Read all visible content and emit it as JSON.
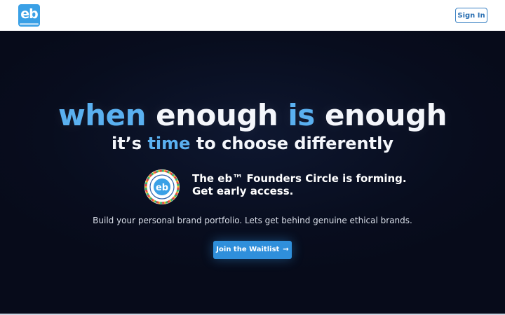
{
  "header": {
    "logo_text": "eb",
    "signin_label": "Sign In"
  },
  "hero": {
    "line1": {
      "w1": "when",
      "w2": "enough",
      "w3": "is",
      "w4": "enough"
    },
    "line2": {
      "w1": "it’s",
      "w2": "time",
      "w3": "to choose differently"
    },
    "founders_line1": "The eb™ Founders Circle is forming.",
    "founders_line2": "Get early access.",
    "seal_text": "eb",
    "tagline": "Build your personal brand portfolio. Lets get behind genuine ethical brands.",
    "cta_label": "Join the Waitlist",
    "cta_icon": "arrow-right-icon"
  },
  "colors": {
    "accent": "#5ab0f0",
    "cta": "#2f8fdb",
    "background": "#080d1e"
  }
}
